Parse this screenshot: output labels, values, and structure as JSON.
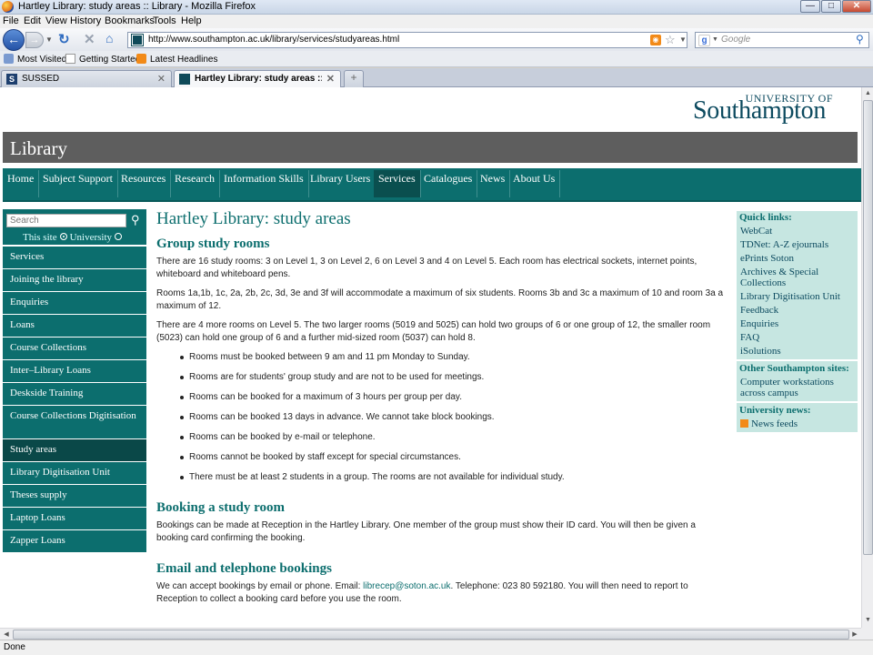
{
  "window": {
    "title": "Hartley Library: study areas :: Library - Mozilla Firefox",
    "controls": [
      "—",
      "□",
      "✕"
    ]
  },
  "menubar": [
    "File",
    "Edit",
    "View",
    "History",
    "Bookmarks",
    "Tools",
    "Help"
  ],
  "navbar": {
    "url": "http://www.southampton.ac.uk/library/services/studyareas.html",
    "search_placeholder": "Google",
    "icons": [
      "back-arrow-icon",
      "forward-arrow-icon",
      "reload-icon",
      "stop-icon",
      "home-icon",
      "rss-icon",
      "star-icon",
      "search-icon"
    ]
  },
  "bookmarks": [
    "Most Visited",
    "Getting Started",
    "Latest Headlines"
  ],
  "tabs": [
    {
      "label": "SUSSED",
      "active": false
    },
    {
      "label": "Hartley Library: study areas :: Libr...",
      "active": true
    }
  ],
  "status": "Done",
  "site": {
    "logo_top": "UNIVERSITY OF",
    "logo_main": "Southampton",
    "section_title": "Library",
    "nav": [
      "Home",
      "Subject Support",
      "Resources",
      "Research",
      "Information Skills",
      "Library Users",
      "Services",
      "Catalogues",
      "News",
      "About Us"
    ],
    "nav_active": "Services",
    "search_placeholder": "Search",
    "scope_this_site": "This site",
    "scope_university": "University",
    "left_nav": [
      "Services",
      "Joining the library",
      "Enquiries",
      "Loans",
      "Course Collections",
      "Inter–Library Loans",
      "Deskside Training",
      "Course Collections Digitisation",
      "Study areas",
      "Library Digitisation Unit",
      "Theses supply",
      "Laptop Loans",
      "Zapper Loans"
    ],
    "left_nav_active": "Study areas"
  },
  "article": {
    "title": "Hartley Library: study areas",
    "h_group": "Group study rooms",
    "p1": "There are 16 study rooms: 3 on Level 1, 3 on Level 2, 6 on Level 3 and 4 on Level 5. Each room has electrical sockets, internet points, whiteboard and whiteboard pens.",
    "p2": "Rooms 1a,1b, 1c, 2a, 2b, 2c, 3d, 3e and 3f will accommodate a maximum of six students. Rooms 3b and 3c a maximum of 10 and room 3a a maximum of 12.",
    "p3": "There are 4 more rooms on Level 5. The two larger rooms (5019 and 5025) can hold two groups of 6 or one group of 12, the smaller room (5023) can hold one group of 6 and a further mid-sized room (5037) can hold 8.",
    "rules": [
      "Rooms must be booked between 9 am and 11 pm Monday to Sunday.",
      "Rooms are for students' group study and are not to be used for meetings.",
      "Rooms can be booked for a maximum of 3 hours per group per day.",
      "Rooms can be booked 13 days in advance. We cannot take block bookings.",
      "Rooms can be booked by e-mail or telephone.",
      "Rooms cannot be booked by staff except for special circumstances.",
      "There must be at least 2 students in a group. The rooms are not available for individual study."
    ],
    "h_booking": "Booking a study room",
    "p_booking": "Bookings can be made at Reception in the Hartley Library. One member of the group must show their ID card. You will then be given a booking card confirming the booking.",
    "h_email": "Email and telephone bookings",
    "p_email_pre": "We can accept bookings by email or phone. Email: ",
    "email": "librecep@soton.ac.uk",
    "p_email_post": ". Telephone: 023 80 592180. You will then need to report to Reception to collect a booking card before you use the room."
  },
  "sidebar": {
    "quick_links_title": "Quick links:",
    "quick_links": [
      "WebCat",
      "TDNet: A-Z ejournals",
      "ePrints Soton",
      "Archives & Special Collections",
      "Library Digitisation Unit",
      "Feedback",
      "Enquiries",
      "FAQ",
      "iSolutions"
    ],
    "other_sites_title": "Other Southampton sites:",
    "other_sites": [
      "Computer workstations across campus"
    ],
    "news_title": "University news:",
    "news_feed": "News feeds"
  },
  "colors": {
    "teal": "#0c6e6e",
    "teal_dark": "#0a4848",
    "grey_bar": "#5e5e5e",
    "sidebar_bg": "#c6e6e1",
    "brand": "#0c4a5f"
  }
}
